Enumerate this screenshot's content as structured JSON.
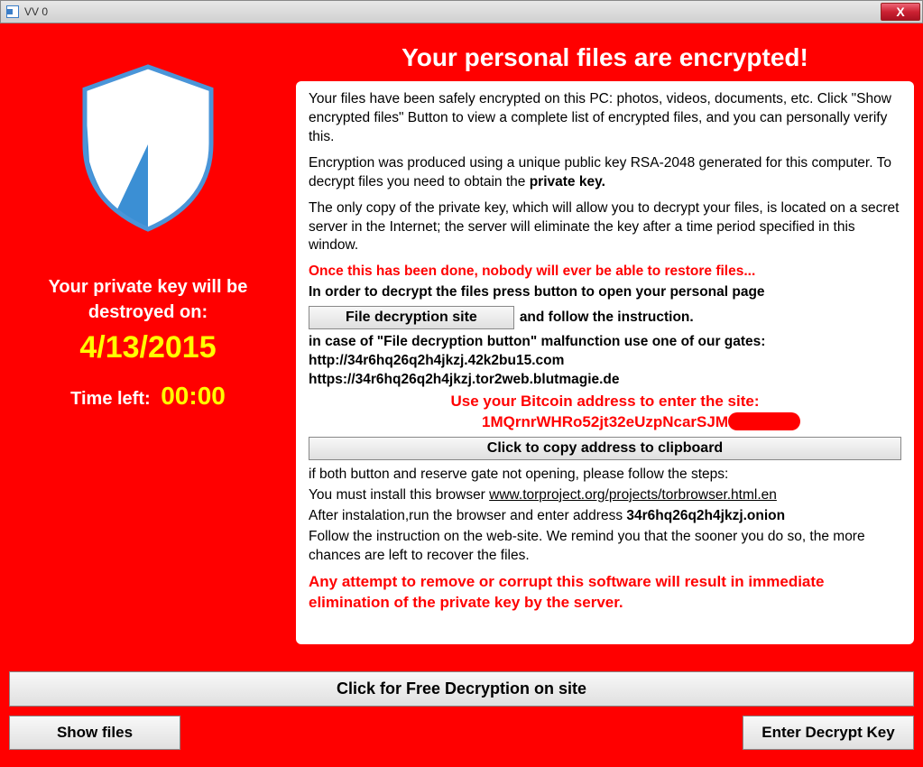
{
  "window": {
    "title": "VV 0",
    "close": "X"
  },
  "left": {
    "destroy_label": "Your private key will be destroyed on:",
    "destroy_date": "4/13/2015",
    "time_left_label": "Time left:",
    "time_left_value": "00:00"
  },
  "heading": "Your personal files are encrypted!",
  "body": {
    "p1": "Your files have been safely encrypted on this PC: photos, videos, documents, etc. Click \"Show encrypted files\" Button to view a complete list of encrypted files, and you can personally verify this.",
    "p2a": "Encryption was produced using a unique public key RSA-2048 generated for this computer. To decrypt files you need to obtain the ",
    "p2b": "private key.",
    "p3": "The only copy of the private key, which will allow you to decrypt your files, is located on a secret server in the Internet; the server will eliminate the key after a time period specified in this window.",
    "p4": "Once this has been done, nobody will ever be able to restore files...",
    "p5": "In order to decrypt the files press button to open your personal page",
    "decrypt_btn": "File decryption site",
    "follow": "and follow the instruction.",
    "gates_intro": "in case of \"File decryption button\" malfunction use one of our gates:",
    "gate1": "http://34r6hq26q2h4jkzj.42k2bu15.com",
    "gate2": "https://34r6hq26q2h4jkzj.tor2web.blutmagie.de",
    "btc_label": "Use your Bitcoin address to  enter the site:",
    "btc_addr": "1MQrnrWHRo52jt32eUzpNcarSJM",
    "copy_btn": "Click to copy address to clipboard",
    "fallback1": "if both button and reserve gate not opening, please follow the steps:",
    "fallback2a": "You must install this browser ",
    "fallback2b": "www.torproject.org/projects/torbrowser.html.en",
    "fallback3a": "After instalation,run the browser and enter address ",
    "fallback3b": "34r6hq26q2h4jkzj.onion",
    "fallback4": "Follow the instruction on the web-site. We remind you that the sooner you do so, the more chances are left to recover the files.",
    "warning": "Any attempt to remove or corrupt this software will result in immediate elimination of the private key by the server."
  },
  "buttons": {
    "free_decrypt": "Click for Free Decryption on site",
    "show_files": "Show files",
    "enter_key": "Enter Decrypt Key"
  }
}
